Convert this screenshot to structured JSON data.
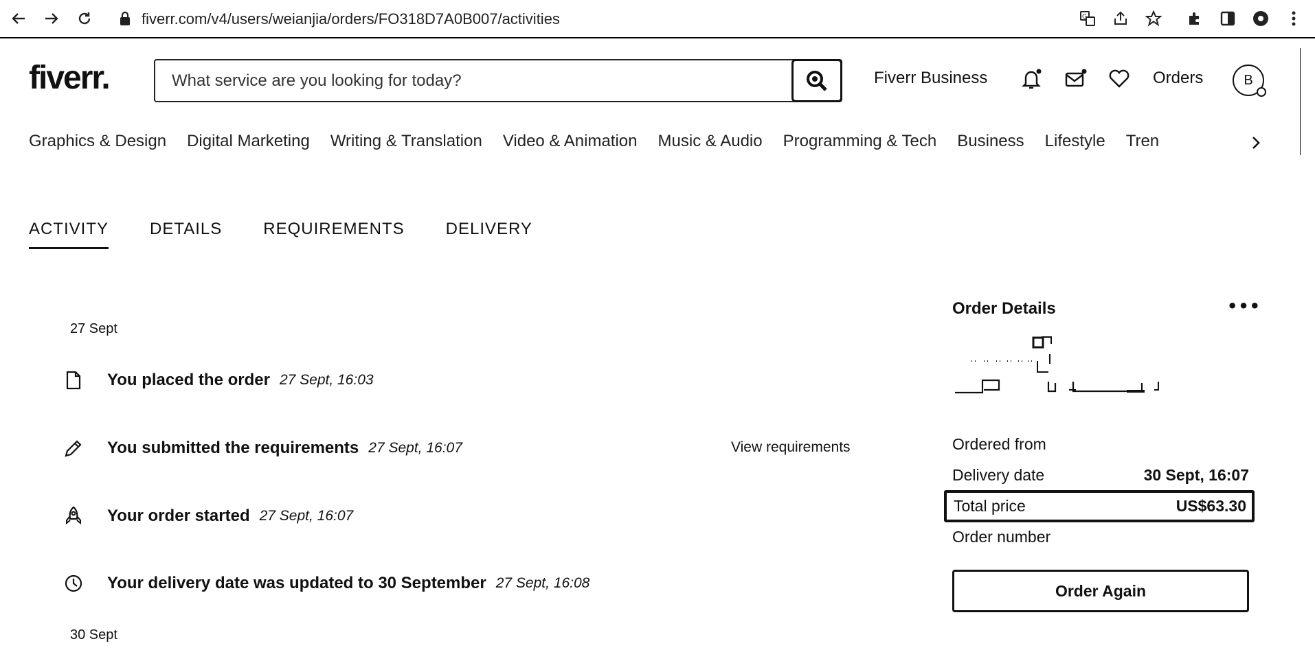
{
  "browser": {
    "url": "fiverr.com/v4/users/weianjia/orders/FO318D7A0B007/activities"
  },
  "header": {
    "logo": "fiverr",
    "logo_dot": ".",
    "search_placeholder": "What service are you looking for today?",
    "fiverr_business": "Fiverr Business",
    "orders": "Orders",
    "avatar_initial": "B"
  },
  "categories": [
    "Graphics & Design",
    "Digital Marketing",
    "Writing & Translation",
    "Video & Animation",
    "Music & Audio",
    "Programming & Tech",
    "Business",
    "Lifestyle",
    "Tren"
  ],
  "tabs": [
    "ACTIVITY",
    "DETAILS",
    "REQUIREMENTS",
    "DELIVERY"
  ],
  "timeline": {
    "day1": "27 Sept",
    "events": [
      {
        "text": "You placed the order",
        "time": "27 Sept, 16:03",
        "icon": "document-icon"
      },
      {
        "text": "You submitted the requirements",
        "time": "27 Sept, 16:07",
        "icon": "pencil-icon"
      },
      {
        "text": "Your order started",
        "time": "27 Sept, 16:07",
        "icon": "rocket-icon"
      },
      {
        "text": "Your delivery date was updated to 30 September",
        "time": "27 Sept, 16:08",
        "icon": "clock-icon"
      }
    ],
    "view_requirements": "View requirements",
    "day2": "30 Sept"
  },
  "order_details": {
    "title": "Order Details",
    "more": "•••",
    "ordered_from_label": "Ordered from",
    "delivery_date_label": "Delivery date",
    "delivery_date_value": "30 Sept, 16:07",
    "total_price_label": "Total price",
    "total_price_value": "US$63.30",
    "order_number_label": "Order number",
    "order_again": "Order Again"
  }
}
